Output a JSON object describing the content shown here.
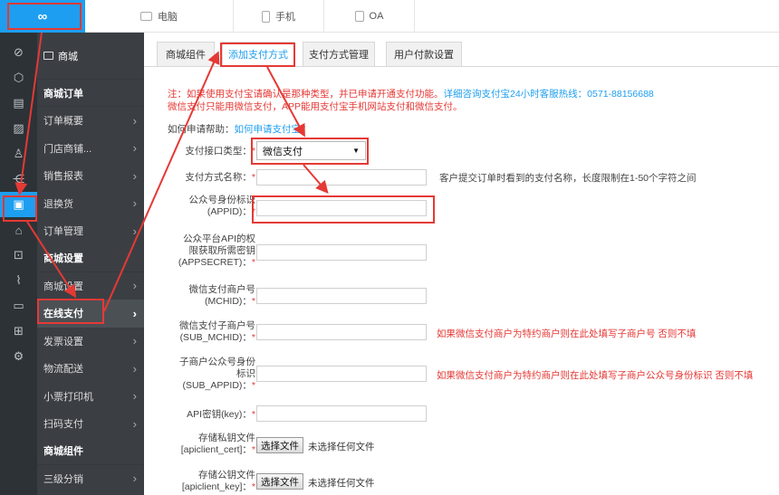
{
  "topbar": {
    "logo": "∞",
    "tabs": [
      {
        "label": "电脑",
        "icon": "monitor-icon"
      },
      {
        "label": "手机",
        "icon": "phone-icon"
      },
      {
        "label": "OA",
        "icon": "document-icon"
      }
    ]
  },
  "rail": {
    "icons": [
      "link-icon",
      "cube-icon",
      "document-icon",
      "image-icon",
      "user-icon",
      "share-icon",
      "clipboard-icon",
      "store-icon",
      "bag-icon",
      "chart-icon",
      "id-card-icon",
      "grid-icon",
      "gear-icon"
    ],
    "active_index": 6
  },
  "sidebar": {
    "shop": "商城",
    "sections": [
      {
        "title": "商城订单",
        "items": [
          "订单概要",
          "门店商铺...",
          "销售报表",
          "退换货",
          "订单管理"
        ]
      },
      {
        "title": "商城设置",
        "items": [
          "商城设置",
          "在线支付",
          "发票设置",
          "物流配送",
          "小票打印机",
          "扫码支付"
        ]
      },
      {
        "title": "商城组件",
        "items": [
          "三级分销"
        ]
      }
    ],
    "active_item": "在线支付"
  },
  "tabs": [
    "商城组件",
    "添加支付方式",
    "支付方式管理",
    "用户付款设置"
  ],
  "active_tab": "添加支付方式",
  "notice": {
    "line1_red": "注：如果使用支付宝请确认是那种类型，并已申请开通支付功能。",
    "line1_blue": "详细咨询支付宝24小时客服热线：0571-88156688",
    "line2": "微信支付只能用微信支付，APP能用支付宝手机网站支付和微信支付。",
    "help_label": "如何申请帮助：",
    "help_link": "如何申请支付宝？"
  },
  "form": {
    "type_label": "支付接口类型：",
    "type_value": "微信支付",
    "name_label": "支付方式名称：",
    "name_hint": "客户提交订单时看到的支付名称，长度限制在1-50个字符之间",
    "appid_l1": "公众号身份标识",
    "appid_l2": "(APPID)：",
    "secret_l1": "公众平台API的权",
    "secret_l2": "限获取所需密钥",
    "secret_l3": "(APPSECRET)：",
    "mchid_l1": "微信支付商户号",
    "mchid_l2": "(MCHID)：",
    "sub_mchid_l1": "微信支付子商户号",
    "sub_mchid_l2": "(SUB_MCHID)：",
    "sub_mchid_hint": "如果微信支付商户为特约商户则在此处填写子商户号 否则不填",
    "sub_appid_l1": "子商户公众号身份",
    "sub_appid_l2": "标识",
    "sub_appid_l3": "(SUB_APPID)：",
    "sub_appid_hint": "如果微信支付商户为特约商户则在此处填写子商户公众号身份标识 否则不填",
    "key_label": "API密钥(key)：",
    "cert_l1": "存储私钥文件",
    "cert_l2": "[apiclient_cert]：",
    "pubkey_l1": "存储公钥文件",
    "pubkey_l2": "[apiclient_key]：",
    "file_button": "选择文件",
    "file_none": "未选择任何文件"
  },
  "colors": {
    "accent": "#1e9ef0",
    "sidebar": "#3b3f44",
    "rail": "#2d3236",
    "highlight": "#e53935"
  }
}
